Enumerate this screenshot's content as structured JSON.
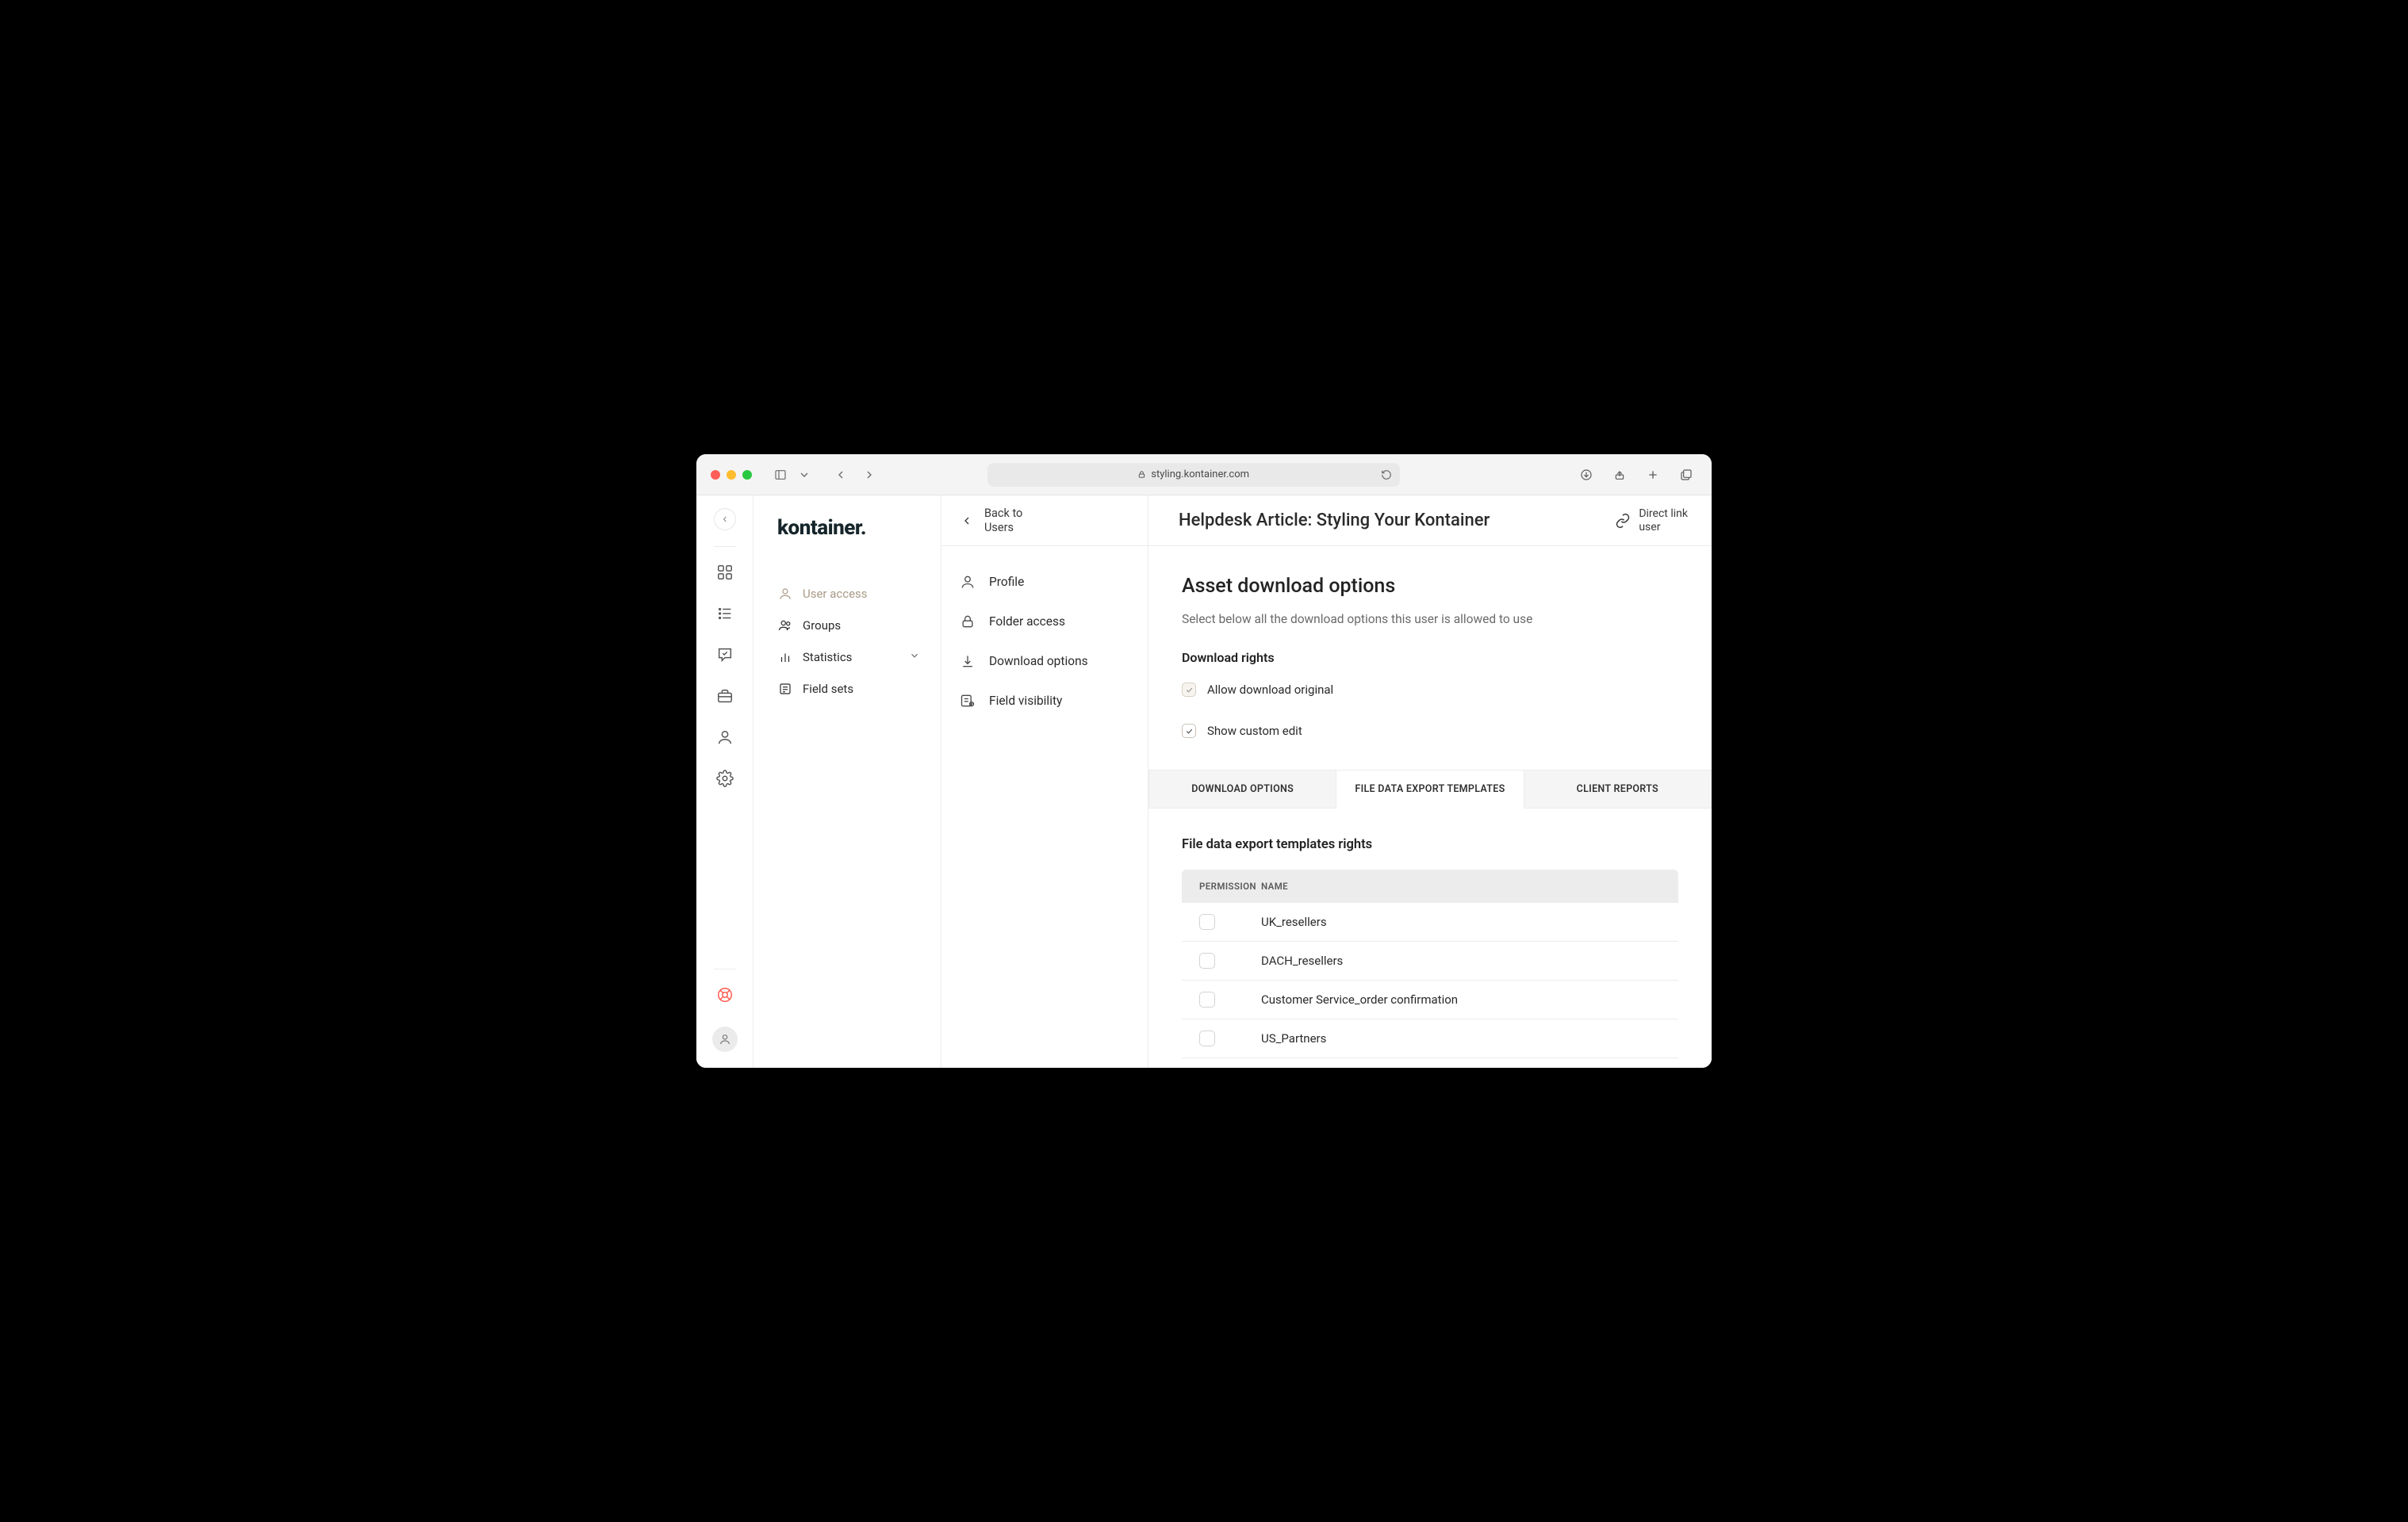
{
  "browser": {
    "url": "styling.kontainer.com"
  },
  "logo": "kontainer.",
  "panel1": {
    "items": [
      {
        "label": "User access",
        "icon": "user",
        "active": true
      },
      {
        "label": "Groups",
        "icon": "users"
      },
      {
        "label": "Statistics",
        "icon": "bars",
        "expandable": true
      },
      {
        "label": "Field sets",
        "icon": "fieldsets"
      }
    ]
  },
  "back": {
    "line1": "Back to",
    "line2": "Users"
  },
  "panel2": {
    "items": [
      {
        "label": "Profile",
        "icon": "user"
      },
      {
        "label": "Folder access",
        "icon": "lock"
      },
      {
        "label": "Download options",
        "icon": "download"
      },
      {
        "label": "Field visibility",
        "icon": "fieldvis"
      }
    ]
  },
  "header": {
    "title": "Helpdesk Article: Styling Your Kontainer",
    "directLink": {
      "line1": "Direct link",
      "line2": "user"
    }
  },
  "main": {
    "sectionTitle": "Asset download options",
    "sectionSub": "Select below all the download options this user is allowed to use",
    "rightsTitle": "Download rights",
    "checks": [
      {
        "label": "Allow download original",
        "checked": true,
        "style": "filled"
      },
      {
        "label": "Show custom edit",
        "checked": true,
        "style": "outline"
      }
    ],
    "tabs": [
      {
        "label": "DOWNLOAD OPTIONS",
        "active": false
      },
      {
        "label": "FILE DATA EXPORT TEMPLATES",
        "active": true
      },
      {
        "label": "CLIENT REPORTS",
        "active": false
      }
    ],
    "tabContent": {
      "heading": "File data export templates rights",
      "columns": {
        "permission": "PERMISSION",
        "name": "NAME"
      },
      "rows": [
        {
          "name": "UK_resellers",
          "checked": false
        },
        {
          "name": "DACH_resellers",
          "checked": false
        },
        {
          "name": "Customer Service_order confirmation",
          "checked": false
        },
        {
          "name": "US_Partners",
          "checked": false
        }
      ]
    }
  }
}
